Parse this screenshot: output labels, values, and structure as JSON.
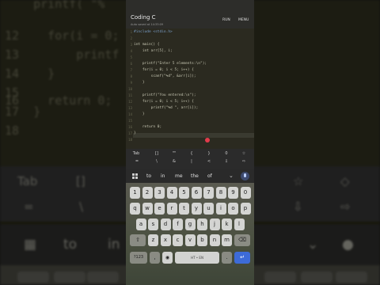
{
  "app": {
    "title": "Coding C",
    "subtitle": "Auto saved at 14:33:09",
    "run_label": "RUN",
    "menu_label": "MENU"
  },
  "editor": {
    "lines": [
      {
        "n": "1",
        "text": "#include <stdio.h>"
      },
      {
        "n": "2",
        "text": ""
      },
      {
        "n": "3",
        "text": "int main() {"
      },
      {
        "n": "4",
        "text": "    int arr[5], i;"
      },
      {
        "n": "5",
        "text": ""
      },
      {
        "n": "6",
        "text": "    printf(\"Enter 5 elements:\\n\");"
      },
      {
        "n": "7",
        "text": "    for(i = 0; i < 5; i++) {"
      },
      {
        "n": "8",
        "text": "        scanf(\"%d\", &arr[i]);"
      },
      {
        "n": "9",
        "text": "    }"
      },
      {
        "n": "10",
        "text": ""
      },
      {
        "n": "11",
        "text": "    printf(\"You entered:\\n\");"
      },
      {
        "n": "12",
        "text": "    for(i = 0; i < 5; i++) {"
      },
      {
        "n": "13",
        "text": "        printf(\"%d \", arr[i]);"
      },
      {
        "n": "14",
        "text": "    }"
      },
      {
        "n": "15",
        "text": ""
      },
      {
        "n": "16",
        "text": "    return 0;"
      },
      {
        "n": "17",
        "text": "}"
      },
      {
        "n": "18",
        "text": ""
      }
    ]
  },
  "symbols": {
    "row1": [
      "Tab",
      "[]",
      "\"\"",
      "{",
      "}",
      "0",
      "☆"
    ],
    "row2": [
      "=",
      "\\",
      "&",
      "|",
      "<",
      "⇩",
      "⇨"
    ]
  },
  "suggestions": [
    "to",
    "in",
    "me",
    "the",
    "of"
  ],
  "keyboard": {
    "numbers": [
      "1",
      "2",
      "3",
      "4",
      "5",
      "6",
      "7",
      "8",
      "9",
      "0"
    ],
    "row1": [
      "q",
      "w",
      "e",
      "r",
      "t",
      "y",
      "u",
      "i",
      "o",
      "p"
    ],
    "row2": [
      "a",
      "s",
      "d",
      "f",
      "g",
      "h",
      "j",
      "k",
      "l"
    ],
    "row3": [
      "z",
      "x",
      "c",
      "v",
      "b",
      "n",
      "m"
    ],
    "shift": "⇧",
    "backspace": "⌫",
    "symbols_key": "?123",
    "comma": ",",
    "space_label": "HT • EN",
    "period": ".",
    "enter": "↵"
  },
  "background": {
    "lines": [
      {
        "n": "",
        "text": "    printf( \"%"
      },
      {
        "n": "12",
        "text": "  for(i = 0; i"
      },
      {
        "n": "13",
        "text": "      printf"
      },
      {
        "n": "14",
        "text": "  }"
      },
      {
        "n": "15",
        "text": ""
      },
      {
        "n": "16",
        "text": "  return 0;"
      },
      {
        "n": "17",
        "text": "}"
      },
      {
        "n": "18",
        "text": ""
      }
    ],
    "left_symbols": [
      "Tab",
      "[]",
      "=",
      "\\"
    ],
    "left_suggestions": [
      "to",
      "in"
    ]
  },
  "colors": {
    "accent": "#3d6bd8",
    "cursor": "#e23b4b"
  }
}
